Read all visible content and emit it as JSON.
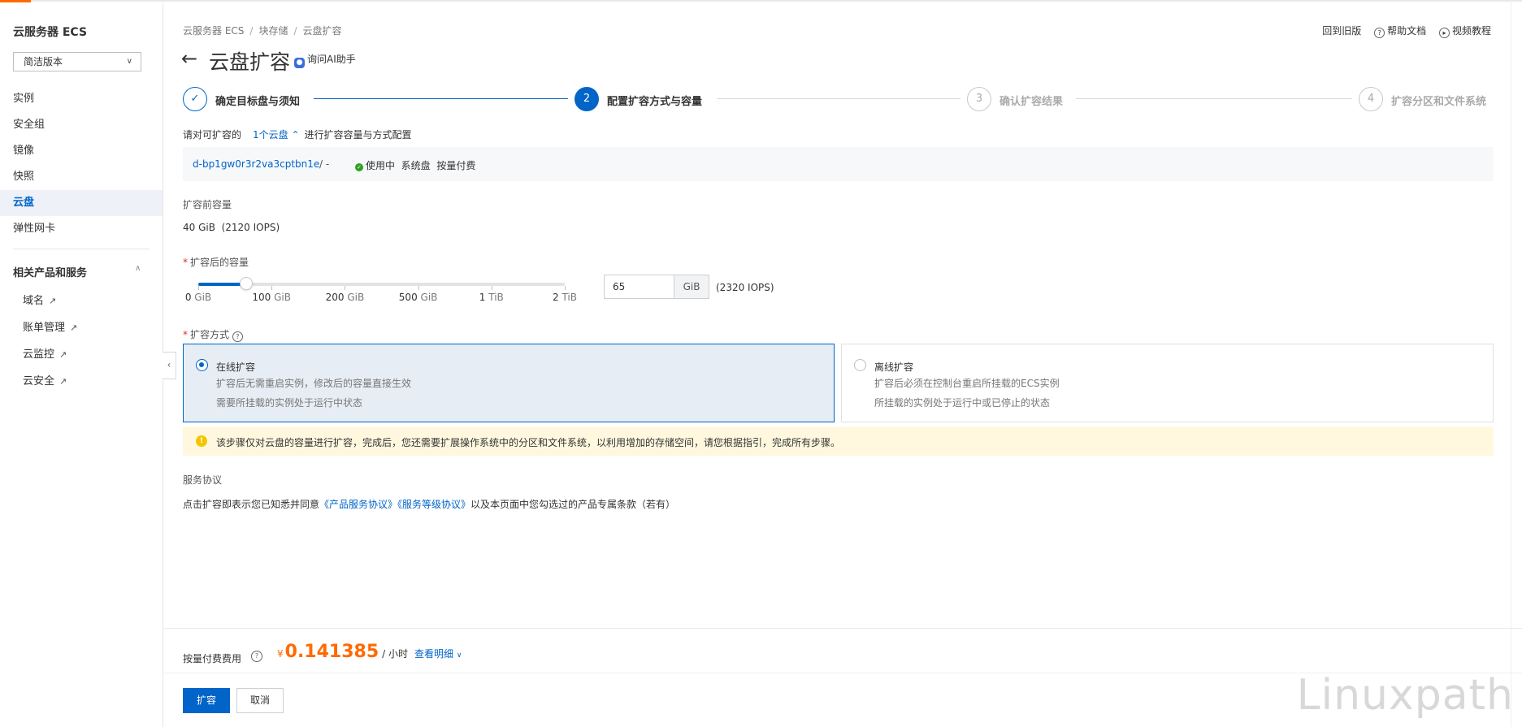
{
  "sidebar": {
    "title": "云服务器 ECS",
    "version_select": "简洁版本",
    "items": [
      {
        "label": "实例"
      },
      {
        "label": "安全组"
      },
      {
        "label": "镜像"
      },
      {
        "label": "快照"
      },
      {
        "label": "云盘"
      },
      {
        "label": "弹性网卡"
      }
    ],
    "section": "相关产品和服务",
    "sub_items": [
      {
        "label": "域名"
      },
      {
        "label": "账单管理"
      },
      {
        "label": "云监控"
      },
      {
        "label": "云安全"
      }
    ]
  },
  "breadcrumb": [
    "云服务器 ECS",
    "块存储",
    "云盘扩容"
  ],
  "top_links": {
    "old": "回到旧版",
    "help": "帮助文档",
    "video": "视频教程"
  },
  "page": {
    "title": "云盘扩容",
    "ai_assistant": "询问AI助手"
  },
  "steps": [
    {
      "num": "✓",
      "label": "确定目标盘与须知",
      "state": "done"
    },
    {
      "num": "2",
      "label": "配置扩容方式与容量",
      "state": "current"
    },
    {
      "num": "3",
      "label": "确认扩容结果",
      "state": "todo"
    },
    {
      "num": "4",
      "label": "扩容分区和文件系统",
      "state": "todo"
    }
  ],
  "config": {
    "prefix": "请对可扩容的",
    "disk_count": "1个云盘",
    "suffix": "进行扩容容量与方式配置"
  },
  "disk": {
    "id": "d-bp1gw0r3r2va3cptbn1e",
    "slash": "/  -",
    "status": "使用中",
    "type": "系统盘",
    "billing": "按量付费"
  },
  "before": {
    "label": "扩容前容量",
    "value": "40 GiB",
    "iops": "(2120 IOPS)"
  },
  "after": {
    "label": "扩容后的容量",
    "slider_value_gib": 65,
    "slider_fraction": 0.13,
    "ticks": [
      {
        "num": "0",
        "unit": "GiB"
      },
      {
        "num": "100",
        "unit": "GiB"
      },
      {
        "num": "200",
        "unit": "GiB"
      },
      {
        "num": "500",
        "unit": "GiB"
      },
      {
        "num": "1",
        "unit": "TiB"
      },
      {
        "num": "2",
        "unit": "TiB"
      }
    ],
    "input_value": "65",
    "unit": "GiB",
    "iops": "(2320 IOPS)"
  },
  "method": {
    "label": "扩容方式",
    "online": {
      "title": "在线扩容",
      "desc1": "扩容后无需重启实例，修改后的容量直接生效",
      "desc2": "需要所挂载的实例处于运行中状态"
    },
    "offline": {
      "title": "离线扩容",
      "desc1": "扩容后必须在控制台重启所挂载的ECS实例",
      "desc2": "所挂载的实例处于运行中或已停止的状态"
    }
  },
  "notice": "该步骤仅对云盘的容量进行扩容，完成后，您还需要扩展操作系统中的分区和文件系统，以利用增加的存储空间，请您根据指引，完成所有步骤。",
  "agreement": {
    "label": "服务协议",
    "prefix": "点击扩容即表示您已知悉并同意",
    "link1": "《产品服务协议》",
    "link2": "《服务等级协议》",
    "suffix": "以及本页面中您勾选过的产品专属条款（若有）"
  },
  "footer": {
    "price_label": "按量付费费用",
    "currency": "¥",
    "price": "0.141385",
    "unit": "/ 小时",
    "detail": "查看明细",
    "confirm": "扩容",
    "cancel": "取消"
  },
  "watermark": "Linuxpath",
  "colors": {
    "primary": "#0064c8",
    "price": "#ff6a00",
    "notice_bg": "#fff8df",
    "success": "#2ea121"
  }
}
